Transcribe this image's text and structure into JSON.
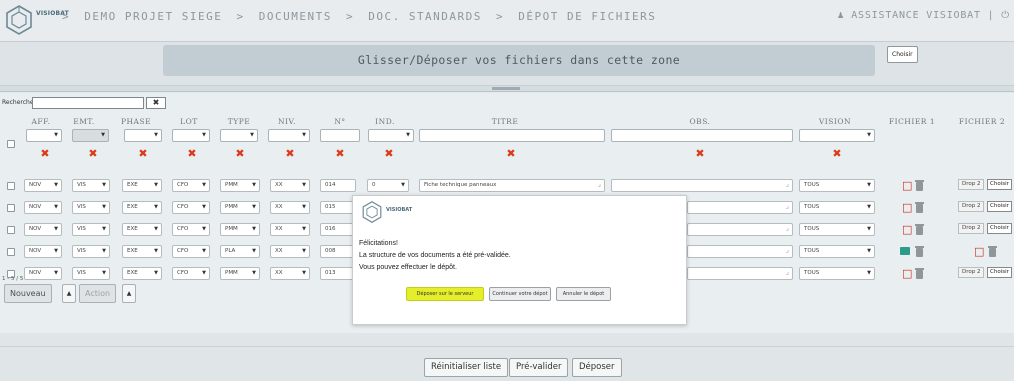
{
  "header": {
    "logo_text": "VISIOBAT",
    "breadcrumb": [
      "DEMO PROJET SIEGE",
      "DOCUMENTS",
      "DOC. STANDARDS",
      "DÉPOT DE FICHIERS"
    ],
    "separator": ">",
    "user": "ASSISTANCE VISIOBAT | "
  },
  "dropzone": {
    "text": "Glisser/Déposer vos fichiers dans cette zone",
    "choose_label": "Choisir"
  },
  "search": {
    "label": "Recherche",
    "value": "",
    "clear_label": "✖"
  },
  "columns": [
    "AFF.",
    "EMT.",
    "PHASE",
    "LOT",
    "TYPE",
    "NIV.",
    "N°",
    "IND.",
    "TITRE",
    "OBS.",
    "VISION",
    "FICHIER 1",
    "FICHIER 2"
  ],
  "rows": [
    {
      "aff": "NOV",
      "emt": "VIS",
      "phase": "EXE",
      "lot": "CFO",
      "type": "PMM",
      "niv": "XX",
      "num": "014",
      "ind": "0",
      "titre": "Fiche technique panneaux",
      "obs": "",
      "vision": "TOUS",
      "f2": "Drop 2",
      "f2_choose": "Choisir"
    },
    {
      "aff": "NOV",
      "emt": "VIS",
      "phase": "EXE",
      "lot": "CFO",
      "type": "PMM",
      "niv": "XX",
      "num": "015",
      "vision": "TOUS",
      "f2": "Drop 2",
      "f2_choose": "Choisir"
    },
    {
      "aff": "NOV",
      "emt": "VIS",
      "phase": "EXE",
      "lot": "CFO",
      "type": "PMM",
      "niv": "XX",
      "num": "016",
      "vision": "TOUS",
      "f2": "Drop 2",
      "f2_choose": "Choisir"
    },
    {
      "aff": "NOV",
      "emt": "VIS",
      "phase": "EXE",
      "lot": "CFO",
      "type": "PLA",
      "niv": "XX",
      "num": "008",
      "vision": "TOUS"
    },
    {
      "aff": "NOV",
      "emt": "VIS",
      "phase": "EXE",
      "lot": "CFO",
      "type": "PMM",
      "niv": "XX",
      "num": "013",
      "vision": "TOUS",
      "f2": "Drop 2",
      "f2_choose": "Choisir"
    }
  ],
  "list": {
    "count": "1 - 5 / 5",
    "new_label": "Nouveau",
    "action_label": "Action",
    "arrow": "▲"
  },
  "footer": {
    "reset_label": "Réinitialiser liste",
    "prevalidate_label": "Pré-valider",
    "deposit_label": "Déposer"
  },
  "modal": {
    "logo_text": "VISIOBAT",
    "line1": "Félicitations!",
    "line2": "La structure de vos documents a été pré-validée.",
    "line3": "Vous pouvez effectuer le dépôt.",
    "btn_deposit": "Déposer sur le serveur",
    "btn_continue": "Continuer votre dépot",
    "btn_cancel": "Annuler le dépot"
  },
  "colors": {
    "accent": "#e4ee2a",
    "error": "#dd3a1c",
    "pdf": "#cf2a1f"
  }
}
